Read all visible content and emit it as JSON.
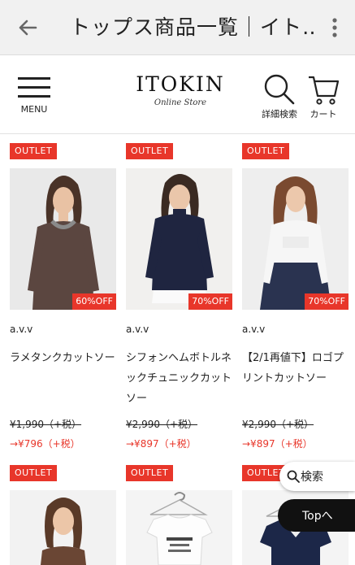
{
  "browser": {
    "title": "トップス商品一覧｜イト…"
  },
  "header": {
    "menu_label": "MENU",
    "logo_main": "ITOKIN",
    "logo_sub": "Online Store",
    "search_label": "詳細検索",
    "cart_label": "カート"
  },
  "products": [
    {
      "badge": "OUTLET",
      "discount": "60%OFF",
      "brand": "a.v.v",
      "name": "ラメタンクカットソー",
      "old_price": "¥1,990（+税）",
      "new_price": "→¥796（+税）"
    },
    {
      "badge": "OUTLET",
      "discount": "70%OFF",
      "brand": "a.v.v",
      "name": "シフォンヘムボトルネックチュニックカットソー",
      "old_price": "¥2,990（+税）",
      "new_price": "→¥897（+税）"
    },
    {
      "badge": "OUTLET",
      "discount": "70%OFF",
      "brand": "a.v.v",
      "name": "【2/1再値下】ロゴプリントカットソー",
      "old_price": "¥2,990（+税）",
      "new_price": "→¥897（+税）"
    },
    {
      "badge": "OUTLET"
    },
    {
      "badge": "OUTLET"
    },
    {
      "badge": "OUTLET"
    }
  ],
  "floating": {
    "search_label": "検索",
    "top_label": "Topへ"
  },
  "colors": {
    "accent": "#e8362a",
    "top_button": "#111111"
  }
}
